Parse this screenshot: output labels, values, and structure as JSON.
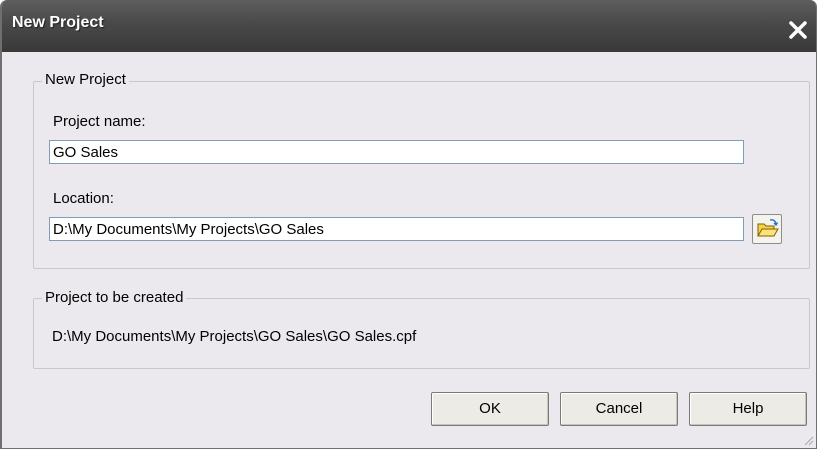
{
  "window": {
    "title": "New Project"
  },
  "icons": {
    "close": "close-icon",
    "browse": "folder-open-icon",
    "grip": "resize-grip-icon"
  },
  "new_project_group": {
    "legend": "New Project",
    "project_name_label": "Project name:",
    "project_name_value": "GO Sales",
    "location_label": "Location:",
    "location_value": "D:\\My Documents\\My Projects\\GO Sales"
  },
  "to_be_created_group": {
    "legend": "Project to be created",
    "path": "D:\\My Documents\\My Projects\\GO Sales\\GO Sales.cpf"
  },
  "buttons": {
    "ok": "OK",
    "cancel": "Cancel",
    "help": "Help"
  },
  "colors": {
    "titlebar": "#494949",
    "dialog_bg": "#ebe9ed",
    "folder": "#f7d34a"
  }
}
